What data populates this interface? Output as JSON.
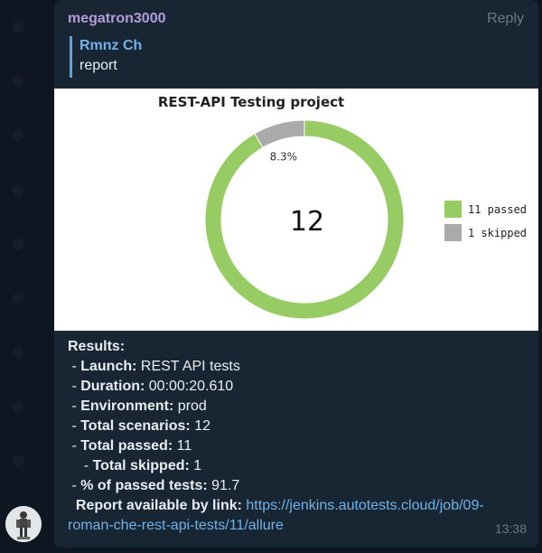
{
  "message": {
    "sender": "megatron3000",
    "reply_label": "Reply",
    "reply_to": {
      "author": "Rmnz Ch",
      "text": "report"
    },
    "time": "13:38"
  },
  "chart_data": {
    "type": "pie",
    "title": "REST-API Testing project",
    "center_label": "12",
    "slices": [
      {
        "label": "11 passed",
        "value": 11,
        "color": "#97cc64"
      },
      {
        "label": "1 skipped",
        "value": 1,
        "color": "#aaaaaa",
        "data_label": "8.3%"
      }
    ],
    "legend_position": "right"
  },
  "results": {
    "heading": "Results:",
    "launch_label": "Launch:",
    "launch_value": "REST API tests",
    "duration_label": "Duration:",
    "duration_value": "00:00:20.610",
    "environment_label": "Environment:",
    "environment_value": "prod",
    "total_scenarios_label": "Total scenarios:",
    "total_scenarios_value": "12",
    "total_passed_label": "Total passed:",
    "total_passed_value": "11",
    "total_skipped_label": "Total skipped:",
    "total_skipped_value": "1",
    "percent_label": "% of passed tests:",
    "percent_value": "91.7",
    "report_label": "Report available by link:",
    "report_link_line1": "https://jenkins.autotests.cloud/job/09-",
    "report_link_line2": "roman-che-rest-api-tests/11/allure"
  }
}
